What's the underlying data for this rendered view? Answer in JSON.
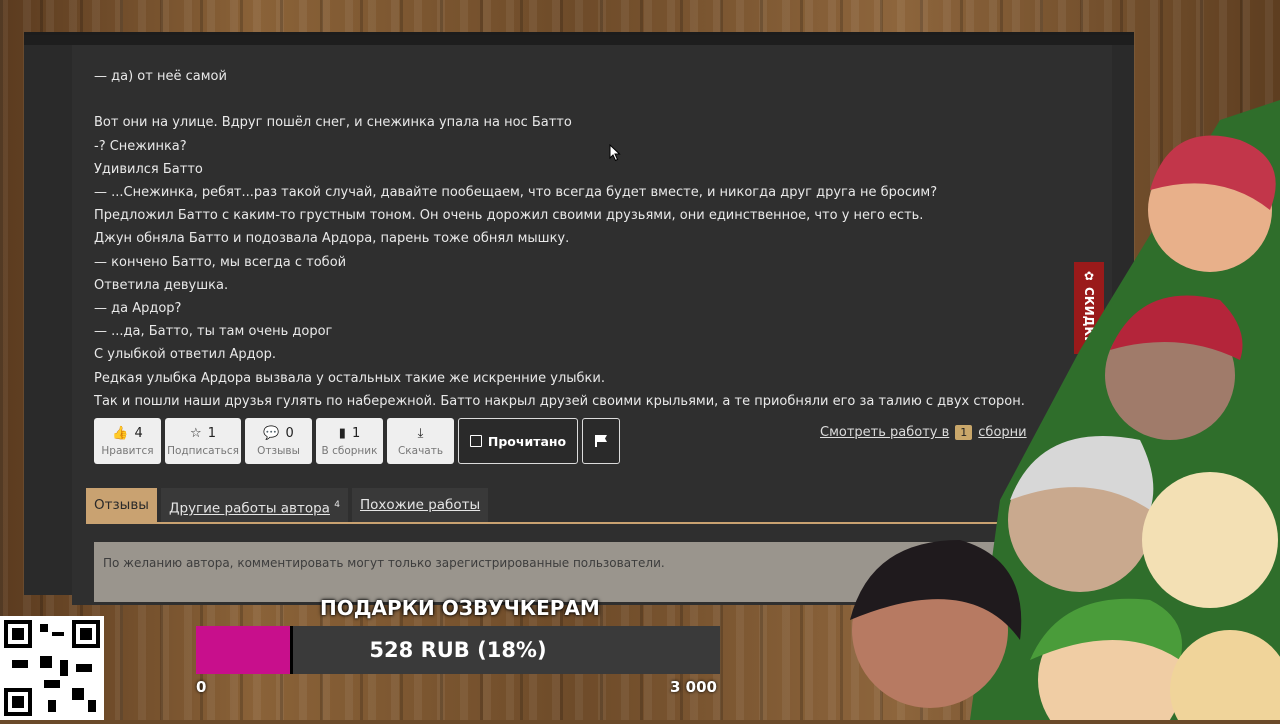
{
  "story_lines": [
    "— да) от неё самой",
    "",
    "Вот они на улице. Вдруг пошёл снег, и снежинка упала на нос Батто",
    "-? Снежинка?",
    "Удивился Батто",
    "— ...Снежинка, ребят...раз такой случай, давайте пообещаем, что всегда будет вместе, и никогда друг друга не бросим?",
    "Предложил Батто с каким-то грустным тоном. Он очень дорожил своими друзьями, они единственное, что у него есть.",
    "Джун обняла Батто и подозвала Ардора, парень тоже обнял мышку.",
    "— кончено Батто, мы всегда с тобой",
    "Ответила девушка.",
    "— да Ардор?",
    "— ...да, Батто, ты там очень дорог",
    "С улыбкой ответил Ардор.",
    "Редкая улыбка Ардора вызвала у остальных такие же искренние улыбки.",
    "Так и пошли наши друзья гулять по набережной. Батто накрыл друзей своими крыльями, а те приобняли его за талию с двух сторон."
  ],
  "actions": {
    "like": {
      "count": "4",
      "label": "Нравится"
    },
    "subscribe": {
      "count": "1",
      "label": "Подписаться"
    },
    "reviews": {
      "count": "0",
      "label": "Отзывы"
    },
    "collection": {
      "count": "1",
      "label": "В сборник"
    },
    "download": {
      "label": "Скачать"
    },
    "read_label": "Прочитано"
  },
  "collection_link": {
    "text": "Смотреть работу в",
    "count": "1",
    "suffix": "сборни"
  },
  "tabs": {
    "reviews": "Отзывы",
    "author_works": "Другие работы автора",
    "author_works_count": "4",
    "similar": "Похожие работы"
  },
  "notice": "По желанию автора, комментировать могут только зарегистрированные пользователи.",
  "discount_label": "СКИДКИ",
  "donation": {
    "title": "ПОДАРКИ ОЗВУЧКЕРАМ",
    "value_text": "528 RUB (18%)",
    "fraction": 0.18,
    "min": "0",
    "max": "3 000"
  },
  "colors": {
    "accent": "#c9a271",
    "donation_fill": "#c80f8c",
    "discount": "#9a1a1a"
  }
}
